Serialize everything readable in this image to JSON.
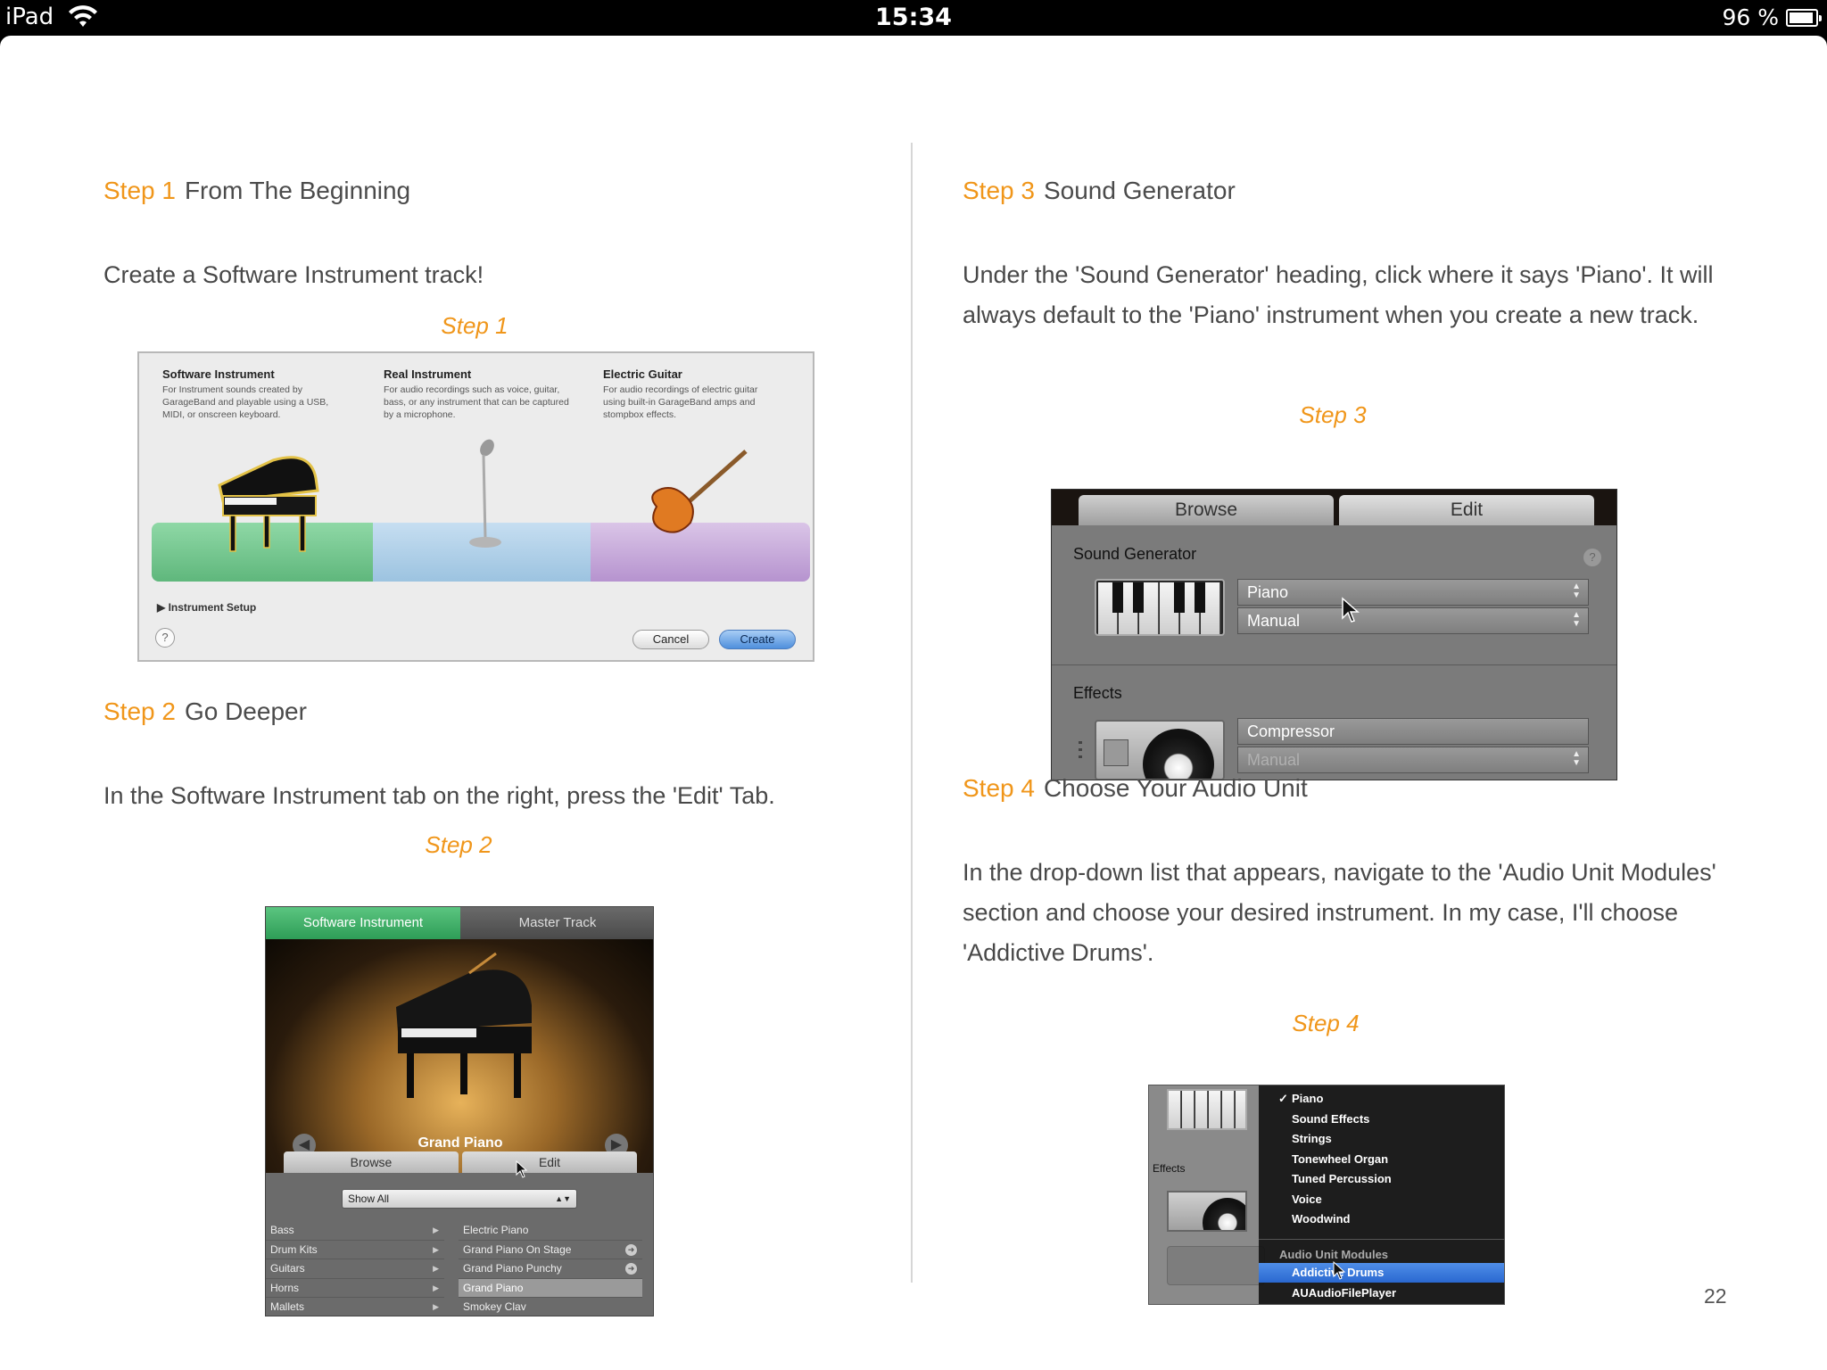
{
  "status_bar": {
    "carrier": "iPad",
    "time": "15:34",
    "battery": "96 %"
  },
  "left": {
    "step1": {
      "num": "Step 1",
      "title": "From The Beginning",
      "body": "Create a Software Instrument track!",
      "caption": "Step 1"
    },
    "fig1": {
      "options": [
        {
          "title": "Software Instrument",
          "desc": "For Instrument sounds created by GarageBand and playable using a USB, MIDI, or onscreen keyboard."
        },
        {
          "title": "Real Instrument",
          "desc": "For audio recordings such as voice, guitar, bass, or any instrument that can be captured by a microphone."
        },
        {
          "title": "Electric Guitar",
          "desc": "For audio recordings of electric guitar using built-in GarageBand amps and stompbox effects."
        }
      ],
      "setup": "Instrument Setup",
      "help": "?",
      "cancel": "Cancel",
      "create": "Create"
    },
    "step2": {
      "num": "Step 2",
      "title": "Go Deeper",
      "body": "In the Software Instrument tab on the right, press the 'Edit' Tab.",
      "caption": "Step 2"
    },
    "fig2": {
      "tab_si": "Software Instrument",
      "tab_mt": "Master Track",
      "instrument": "Grand Piano",
      "browse": "Browse",
      "edit": "Edit",
      "filter": "Show All",
      "categories": [
        "Bass",
        "Drum Kits",
        "Guitars",
        "Horns",
        "Mallets"
      ],
      "presets": [
        "Electric Piano",
        "Grand Piano On Stage",
        "Grand Piano Punchy",
        "Grand Piano",
        "Smokey Clav"
      ]
    }
  },
  "right": {
    "step3": {
      "num": "Step 3",
      "title": "Sound Generator",
      "body": "Under the 'Sound Generator' heading, click where it says 'Piano'. It will always default to the 'Piano' instrument when you create a new track.",
      "caption": "Step 3"
    },
    "fig3": {
      "browse": "Browse",
      "edit": "Edit",
      "sound_generator": "Sound Generator",
      "help": "?",
      "piano": "Piano",
      "manual": "Manual",
      "effects": "Effects",
      "compressor": "Compressor",
      "manual2": "Manual"
    },
    "step4": {
      "num": "Step 4",
      "title": "Choose Your Audio Unit",
      "body": "In the drop-down list that appears, navigate to the 'Audio Unit Modules' section and choose your desired instrument. In my case, I'll choose 'Addictive Drums'.",
      "caption": "Step 4"
    },
    "fig4": {
      "effects": "Effects",
      "check": "✓",
      "menu": [
        "Piano",
        "Sound Effects",
        "Strings",
        "Tonewheel Organ",
        "Tuned Percussion",
        "Voice",
        "Woodwind"
      ],
      "section": "Audio Unit Modules",
      "selected": "Addictive Drums",
      "last": "AUAudioFilePlayer"
    }
  },
  "page_number": "22"
}
